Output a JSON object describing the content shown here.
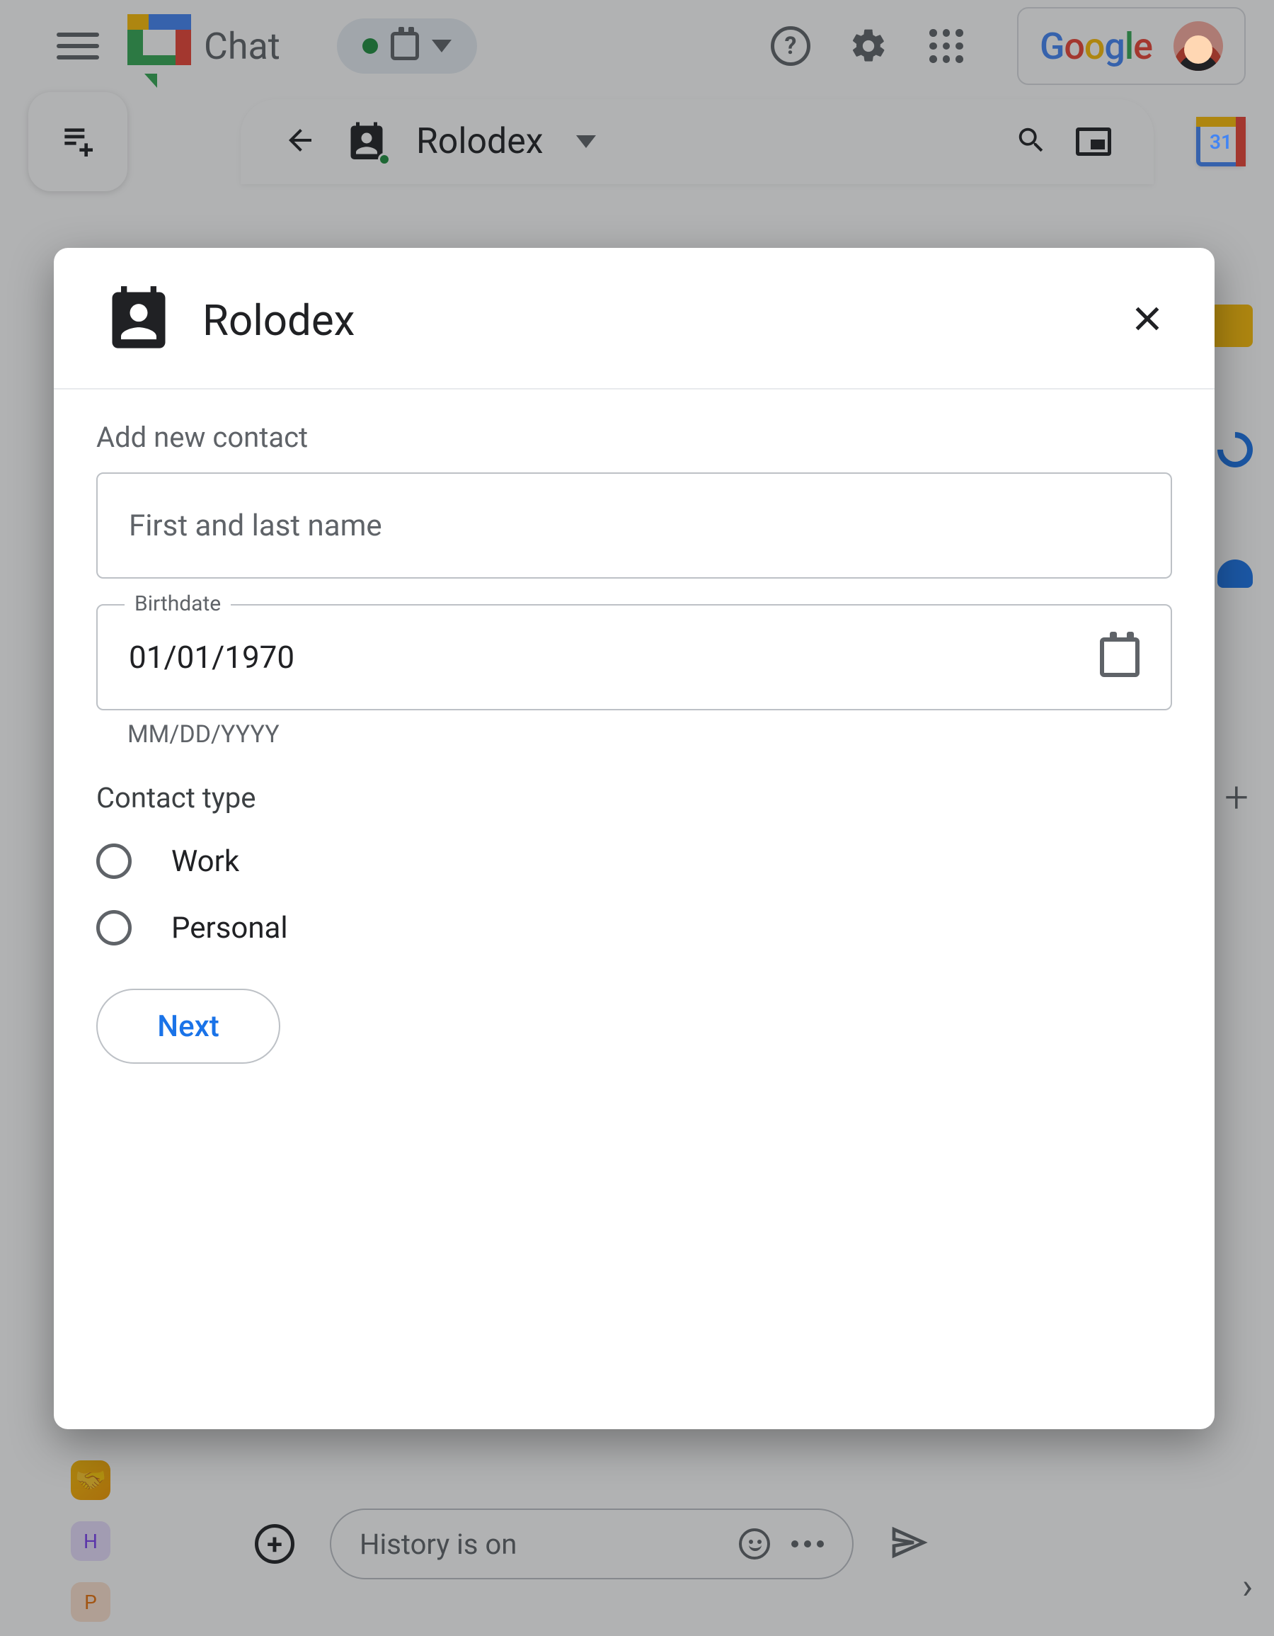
{
  "topbar": {
    "app_name": "Chat",
    "google_word": "Google",
    "calendar_day": "31"
  },
  "subbar": {
    "space_name": "Rolodex"
  },
  "compose": {
    "placeholder": "History is on"
  },
  "left_chips": {
    "h": "H",
    "p": "P"
  },
  "dialog": {
    "title": "Rolodex",
    "add_contact_label": "Add new contact",
    "name_placeholder": "First and last name",
    "birthdate_legend": "Birthdate",
    "birthdate_value": "01/01/1970",
    "birthdate_help": "MM/DD/YYYY",
    "contact_type_label": "Contact type",
    "option_work": "Work",
    "option_personal": "Personal",
    "next_label": "Next"
  }
}
